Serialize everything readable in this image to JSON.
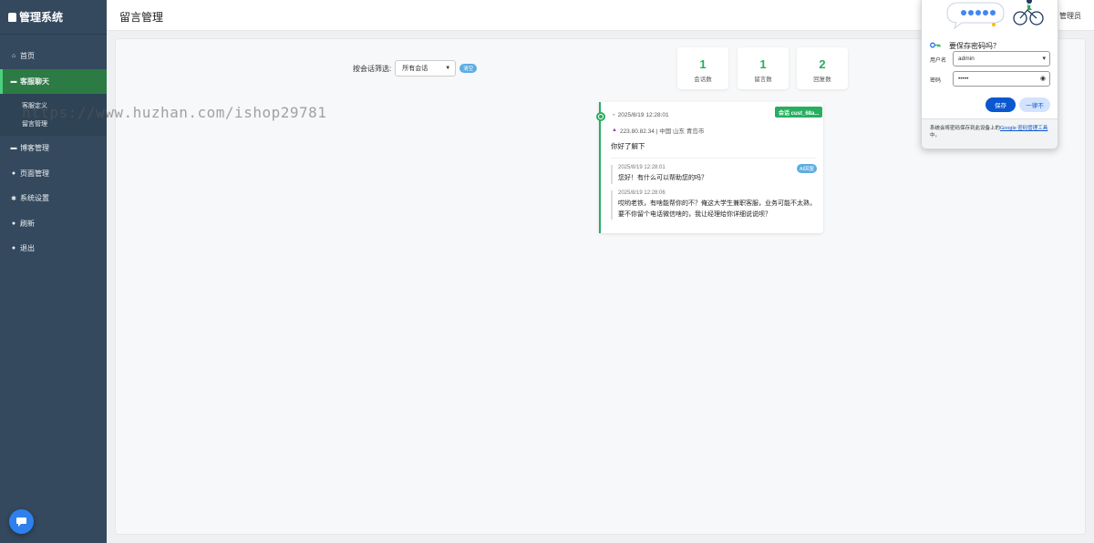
{
  "sidebar": {
    "brand": "管理系统",
    "items": [
      {
        "icon": "home-icon",
        "glyph": "⌂",
        "label": "首页"
      },
      {
        "icon": "chat-icon",
        "glyph": "▬",
        "label": "客服聊天"
      },
      {
        "icon": "blog-icon",
        "glyph": "▬",
        "label": "博客管理"
      },
      {
        "icon": "user-icon",
        "glyph": "●",
        "label": "页面管理"
      },
      {
        "icon": "gear-icon",
        "glyph": "✱",
        "label": "系统设置"
      },
      {
        "icon": "refresh-icon",
        "glyph": "●",
        "label": "刷新"
      },
      {
        "icon": "logout-icon",
        "glyph": "●",
        "label": "退出"
      }
    ],
    "subitems": [
      {
        "label": "客服定义"
      },
      {
        "label": "留言管理"
      }
    ]
  },
  "header": {
    "title": "留言管理",
    "user": "管理员"
  },
  "filter": {
    "label": "按会话筛选:",
    "selected": "所有会话",
    "clear": "清空"
  },
  "stats": [
    {
      "value": "1",
      "label": "会话数"
    },
    {
      "value": "1",
      "label": "留言数"
    },
    {
      "value": "2",
      "label": "回复数"
    }
  ],
  "message": {
    "time": "2025/8/19 12:28:01",
    "ip_location": "223.80.82.34 | 中国 山东 青岛市",
    "session_badge": "会话 cust_68a...",
    "text": "你好了解下",
    "replies": [
      {
        "time": "2025/8/19 12:28:01",
        "badge": "AI回复",
        "text": "您好！有什么可以帮助您的吗？"
      },
      {
        "time": "2025/8/19 12:28:06",
        "text": "哎哟老铁，有啥能帮你的不？俺这大学生兼职客服，业务可能不太熟，要不你留个电话微信啥的，我让经理给你详细说说呗？"
      }
    ]
  },
  "password_popup": {
    "question": "要保存密码吗？",
    "username_label": "用户名",
    "username_value": "admin",
    "password_label": "密码",
    "password_value": "•••••",
    "save": "保存",
    "never": "一律不",
    "footer_text": "系统会将密码保存到此设备上的",
    "footer_link": "Google 密码管理工具",
    "footer_end": "中。"
  },
  "watermark": "https://www.huzhan.com/ishop29781",
  "colors": {
    "sidebar": "#34495e",
    "accent": "#27ae60",
    "active_nav": "#2c7a44",
    "badge_blue": "#5dade2",
    "google_blue": "#0b57d0"
  }
}
